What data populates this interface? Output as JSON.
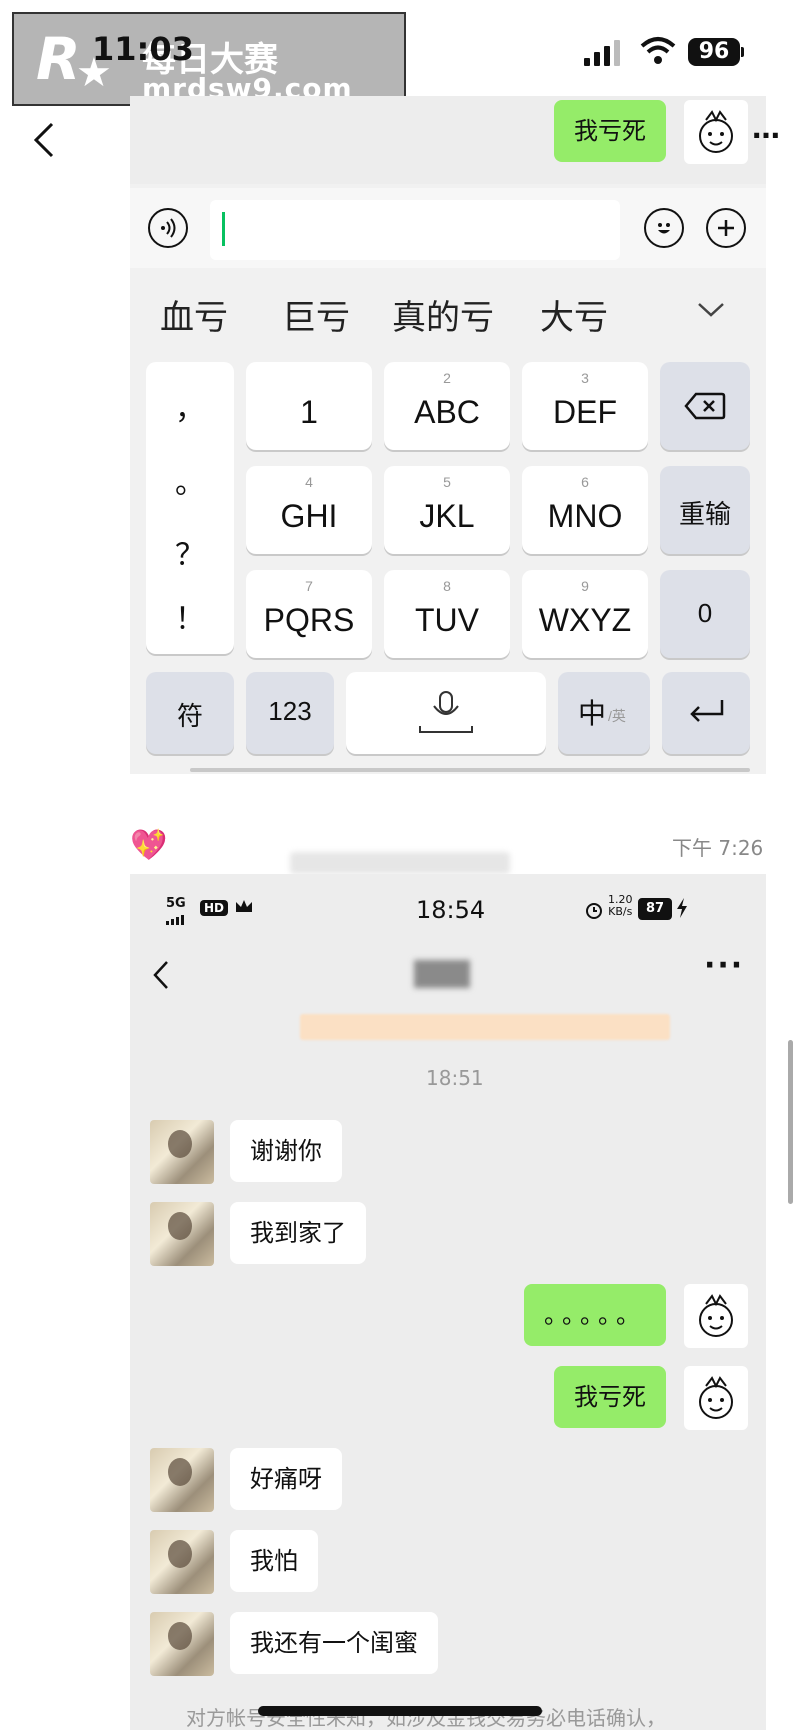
{
  "watermark": {
    "logo_letter": "R",
    "line1": "每日大赛",
    "line2": "mrdsw9.com"
  },
  "status_bar": {
    "time": "11:03",
    "battery": "96"
  },
  "top_chat": {
    "sent_message": "我亏死"
  },
  "keyboard": {
    "candidates": [
      "血亏",
      "巨亏",
      "真的亏",
      "大亏"
    ],
    "punctuation": [
      "，",
      "。",
      "？",
      "！"
    ],
    "rows": [
      [
        {
          "num": "",
          "label": "1"
        },
        {
          "num": "2",
          "label": "ABC"
        },
        {
          "num": "3",
          "label": "DEF"
        }
      ],
      [
        {
          "num": "4",
          "label": "GHI"
        },
        {
          "num": "5",
          "label": "JKL"
        },
        {
          "num": "6",
          "label": "MNO"
        }
      ],
      [
        {
          "num": "7",
          "label": "PQRS"
        },
        {
          "num": "8",
          "label": "TUV"
        },
        {
          "num": "9",
          "label": "WXYZ"
        }
      ]
    ],
    "retype": "重输",
    "zero": "0",
    "symbols": "符",
    "numbers": "123",
    "lang_main": "中",
    "lang_alt": "/英"
  },
  "separator": {
    "time": "下午 7:26"
  },
  "inner_screen": {
    "status": {
      "network": "5G",
      "hd": "HD",
      "time": "18:54",
      "speed_top": "1.20",
      "speed_bottom": "KB/s",
      "battery": "87"
    },
    "timestamp": "18:51",
    "messages": [
      {
        "from": "them",
        "text": "谢谢你"
      },
      {
        "from": "them",
        "text": "我到家了"
      },
      {
        "from": "me",
        "text": "。。。。。"
      },
      {
        "from": "me",
        "text": "我亏死"
      },
      {
        "from": "them",
        "text": "好痛呀"
      },
      {
        "from": "them",
        "text": "我怕"
      },
      {
        "from": "them",
        "text": "我还有一个闺蜜"
      }
    ],
    "footer_notice": "对方帐号安全性未知，如涉及金钱交易务必电话确认，"
  }
}
